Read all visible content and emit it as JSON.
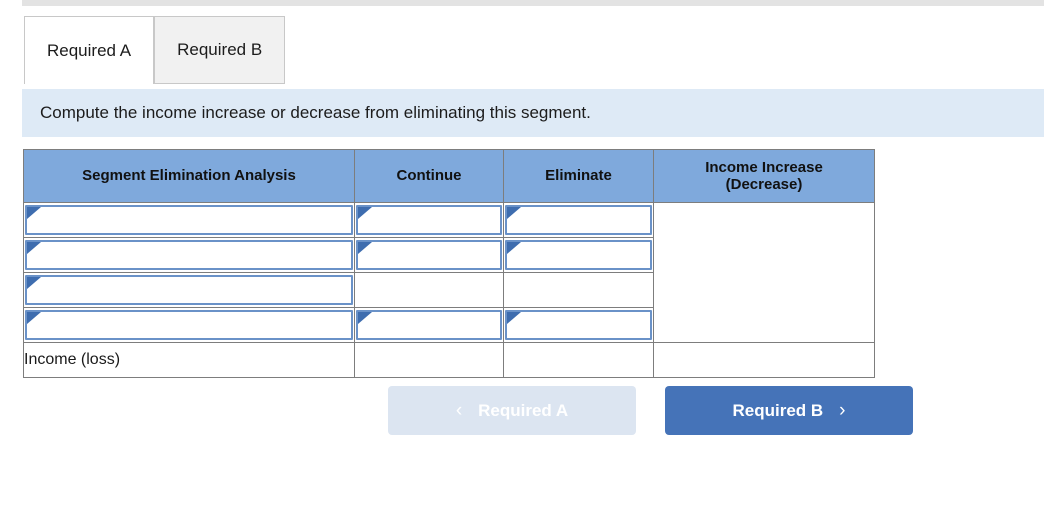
{
  "tabs": [
    {
      "label": "Required A",
      "active": true
    },
    {
      "label": "Required B",
      "active": false
    }
  ],
  "banner": {
    "text": "Compute the income increase or decrease from eliminating this segment."
  },
  "table": {
    "headers": [
      "Segment Elimination Analysis",
      "Continue",
      "Eliminate",
      "Income Increase (Decrease)"
    ],
    "header_income_line1": "Income Increase",
    "header_income_line2": "(Decrease)",
    "rows": [
      {
        "label": "",
        "continue": "",
        "eliminate": ""
      },
      {
        "label": "",
        "continue": "",
        "eliminate": ""
      },
      {
        "label": "",
        "continue": "",
        "eliminate": ""
      },
      {
        "label": "",
        "continue": "",
        "eliminate": ""
      }
    ],
    "total_row": {
      "label": "Income (loss)",
      "continue": "",
      "eliminate": "",
      "income_increase": ""
    },
    "income_increase_merged_value": ""
  },
  "footer": {
    "prev_label": "Required A",
    "prev_chevron": "‹",
    "next_label": "Required B",
    "next_chevron": "›"
  },
  "colors": {
    "header_blue": "#7fa9dc",
    "banner_blue": "#deeaf6",
    "primary_button": "#4573b8",
    "disabled_button": "#dce5f1",
    "input_border": "#6a92c8",
    "marker": "#3e6daf"
  }
}
